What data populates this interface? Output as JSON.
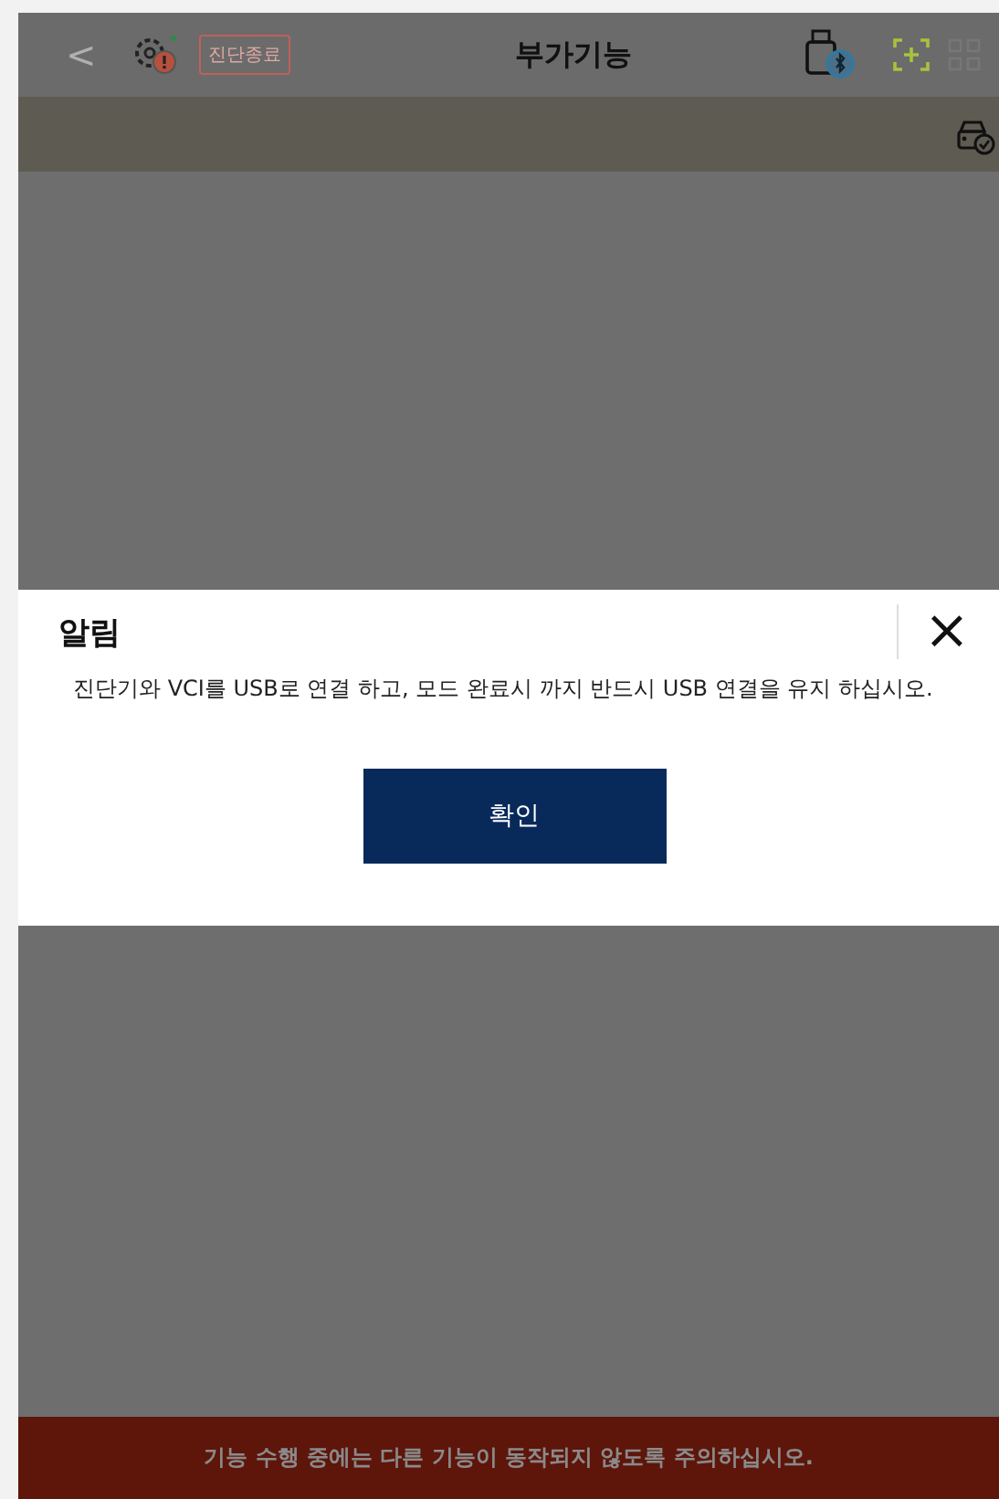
{
  "header": {
    "back": "<",
    "badge": "진단종료",
    "title": "부가기능"
  },
  "dialog": {
    "title": "알림",
    "close": "×",
    "message": "진단기와 VCI를 USB로 연결 하고, 모드 완료시 까지 반드시 USB 연결을 유지 하십시오.",
    "confirm": "확인"
  },
  "footer": {
    "notice": "기능 수행 중에는 다른 기능이 동작되지 않도록 주의하십시오."
  }
}
